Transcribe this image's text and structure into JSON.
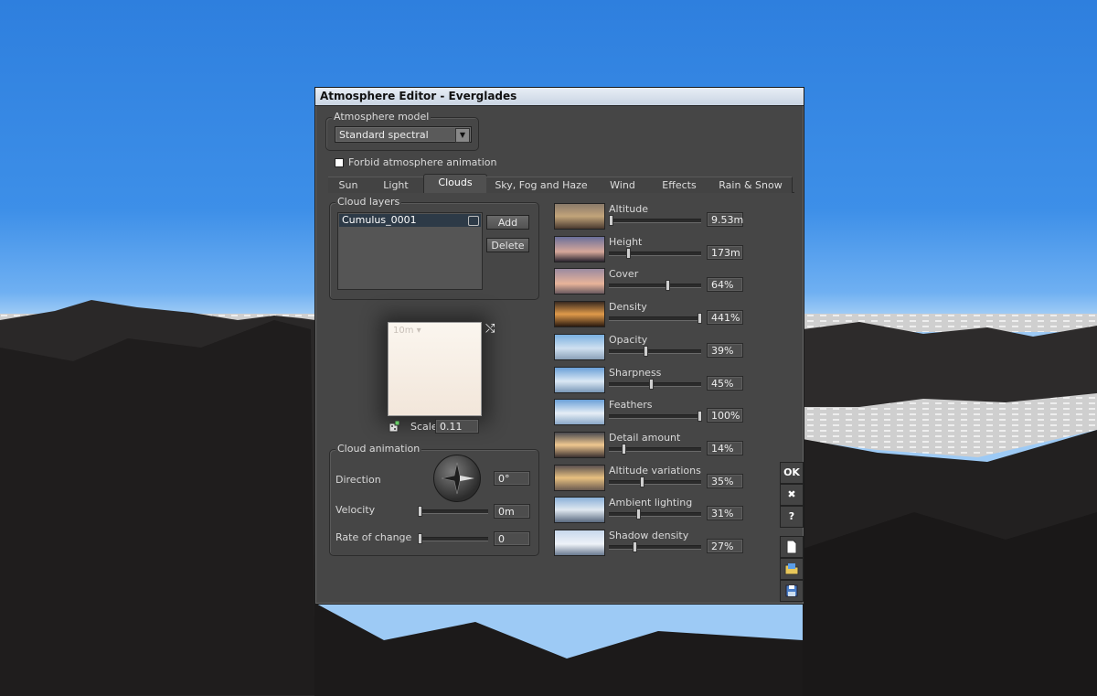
{
  "window": {
    "title": "Atmosphere Editor - Everglades"
  },
  "atmosphere_model": {
    "group_label": "Atmosphere model",
    "selected": "Standard spectral"
  },
  "forbid_animation": {
    "label": "Forbid atmosphere animation",
    "checked": false
  },
  "tabs": [
    "Sun",
    "Light",
    "Clouds",
    "Sky, Fog and Haze",
    "Wind",
    "Effects",
    "Rain & Snow"
  ],
  "active_tab": "Clouds",
  "cloud_layers": {
    "group_label": "Cloud layers",
    "items": [
      "Cumulus_0001"
    ],
    "add_label": "Add",
    "delete_label": "Delete"
  },
  "preview": {
    "label": "10m",
    "scale_label": "Scale",
    "scale_value": "0.11"
  },
  "cloud_animation": {
    "group_label": "Cloud animation",
    "direction": {
      "label": "Direction",
      "value": "0°"
    },
    "velocity": {
      "label": "Velocity",
      "value": "0m",
      "level": 0
    },
    "rate_of_change": {
      "label": "Rate of change",
      "value": "0",
      "level": 0
    }
  },
  "params": [
    {
      "label": "Altitude",
      "value": "9.53m",
      "level": 0.0
    },
    {
      "label": "Height",
      "value": "173m",
      "level": 0.2
    },
    {
      "label": "Cover",
      "value": "64%",
      "level": 0.64
    },
    {
      "label": "Density",
      "value": "441%",
      "level": 1.0
    },
    {
      "label": "Opacity",
      "value": "39%",
      "level": 0.39
    },
    {
      "label": "Sharpness",
      "value": "45%",
      "level": 0.45
    },
    {
      "label": "Feathers",
      "value": "100%",
      "level": 1.0
    },
    {
      "label": "Detail amount",
      "value": "14%",
      "level": 0.14
    },
    {
      "label": "Altitude variations",
      "value": "35%",
      "level": 0.35
    },
    {
      "label": "Ambient lighting",
      "value": "31%",
      "level": 0.31
    },
    {
      "label": "Shadow density",
      "value": "27%",
      "level": 0.27
    }
  ],
  "side_buttons": {
    "ok": "OK",
    "cancel": "✖",
    "help": "?"
  },
  "icons": [
    "new-file-icon",
    "open-folder-icon",
    "save-icon",
    "dice-icon",
    "random-icon",
    "compass-dial-icon",
    "layer-visibility-icon"
  ]
}
